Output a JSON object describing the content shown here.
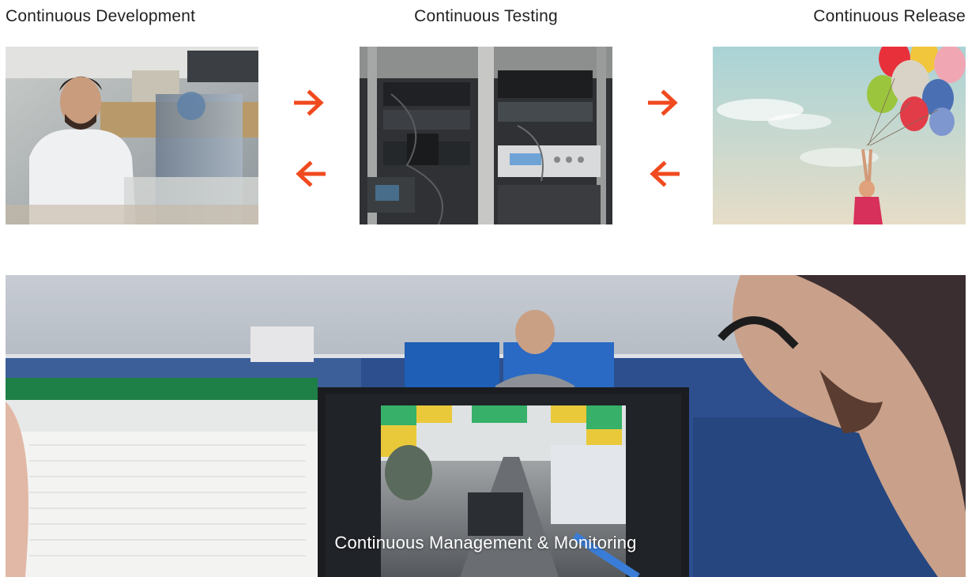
{
  "stages": {
    "development": {
      "title": "Continuous Development"
    },
    "testing": {
      "title": "Continuous Testing"
    },
    "release": {
      "title": "Continuous Release"
    }
  },
  "banner": {
    "caption": "Continuous Management & Monitoring"
  },
  "colors": {
    "arrow": "#f04a1e",
    "text": "#222222",
    "caption": "#ffffff"
  },
  "icons": [
    "arrow-right-icon",
    "arrow-left-icon"
  ]
}
